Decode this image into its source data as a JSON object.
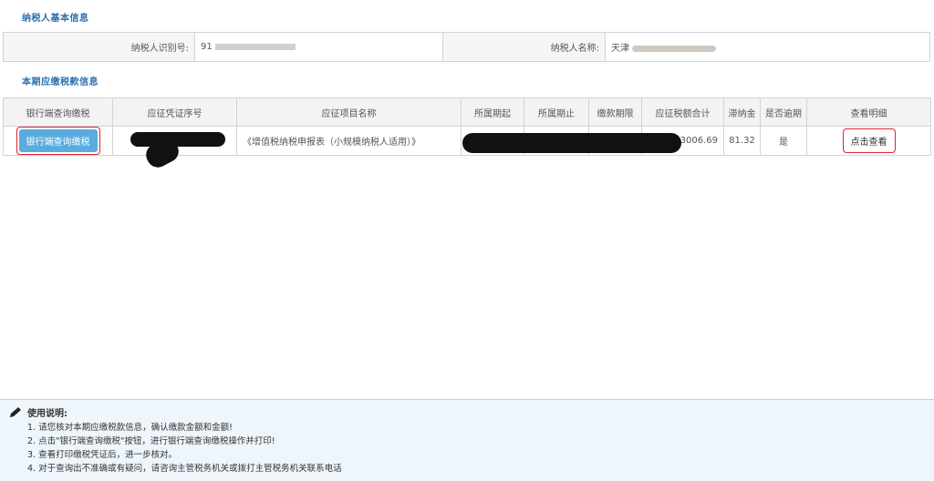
{
  "basic_info": {
    "title": "纳税人基本信息",
    "taxpayer_id_label": "纳税人识别号:",
    "taxpayer_id_value": "91",
    "taxpayer_name_label": "纳税人名称:",
    "taxpayer_name_value": "天津"
  },
  "tax_info": {
    "title": "本期应缴税款信息",
    "columns": [
      "银行端查询缴税",
      "应征凭证序号",
      "应征项目名称",
      "所属期起",
      "所属期止",
      "缴款期限",
      "应征税额合计",
      "滞纳金",
      "是否逾期",
      "查看明细"
    ],
    "rows": [
      {
        "pay_button": "银行端查询缴税",
        "voucher_no": "",
        "item_name": "《增值税纳税申报表（小规模纳税人适用）》",
        "period_start": "",
        "period_end": "",
        "deadline": "",
        "total": "3006.69",
        "late_fee": "81.32",
        "overdue": "是",
        "detail_link": "点击查看"
      }
    ]
  },
  "guide": {
    "title": "使用说明:",
    "items": [
      "1. 请您核对本期应缴税款信息，确认缴款金额和金额!",
      "2. 点击\"银行端查询缴税\"按钮，进行银行端查询缴税操作并打印!",
      "3. 查看打印缴税凭证后，进一步核对。",
      "4. 对于查询出不准确或有疑问，请咨询主管税务机关或拨打主管税务机关联系电话"
    ]
  }
}
